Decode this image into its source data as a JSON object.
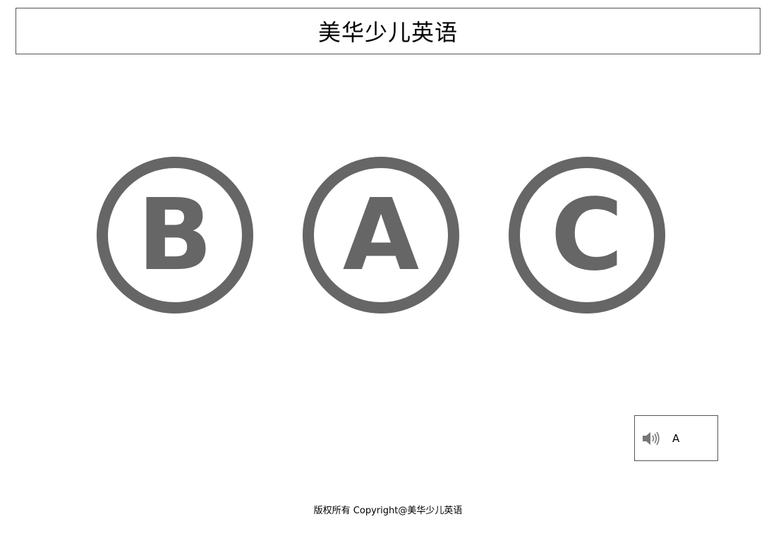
{
  "header": {
    "title": "美华少儿英语"
  },
  "choices": [
    {
      "letter": "B"
    },
    {
      "letter": "A"
    },
    {
      "letter": "C"
    }
  ],
  "audio": {
    "icon": "speaker-icon",
    "label": "A"
  },
  "footer": {
    "copyright": "版权所有 Copyright@美华少儿英语"
  },
  "colors": {
    "circle": "#666666",
    "border": "#555555"
  }
}
